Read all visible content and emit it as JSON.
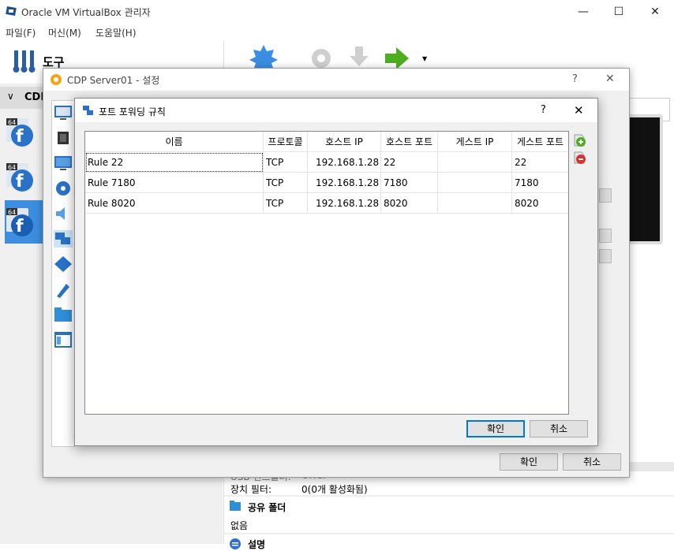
{
  "main_window": {
    "title": "Oracle VM VirtualBox 관리자",
    "menu": [
      "파일(F)",
      "머신(M)",
      "도움말(H)"
    ],
    "tools_label": "도구",
    "group_label": "CDP",
    "details": {
      "usb_label_partial": "USB 컨트롤러:",
      "usb_value_partial": "OHCI",
      "device_filter_label": "장치 필터:",
      "device_filter_value": "0(0개 활성화됨)",
      "shared_folders_header": "공유 폴더",
      "shared_folders_value": "없음",
      "description_header": "설명"
    }
  },
  "settings_dialog": {
    "title": "CDP Server01 - 설정",
    "help": "?",
    "close": "✕",
    "ok_label": "확인",
    "cancel_label": "취소"
  },
  "pf_dialog": {
    "title": "포트 포워딩 규칙",
    "help": "?",
    "close": "✕",
    "ok_label": "확인",
    "cancel_label": "취소",
    "columns": [
      "이름",
      "프로토콜",
      "호스트 IP",
      "호스트 포트",
      "게스트 IP",
      "게스트 포트"
    ],
    "rows": [
      [
        "Rule 22",
        "TCP",
        "192.168.1.28",
        "22",
        "",
        "22"
      ],
      [
        "Rule 7180",
        "TCP",
        "192.168.1.28",
        "7180",
        "",
        "7180"
      ],
      [
        "Rule 8020",
        "TCP",
        "192.168.1.28",
        "8020",
        "",
        "8020"
      ]
    ]
  },
  "colors": {
    "selection": "#3d8ee0",
    "accent": "#0078d7",
    "add_icon": "#4cae1e",
    "remove_icon": "#d9302a"
  },
  "icons": [
    "virtualbox-icon",
    "tools-icon",
    "fedora-icon",
    "gear-icon",
    "add-rule-icon",
    "remove-rule-icon",
    "network-icon"
  ]
}
